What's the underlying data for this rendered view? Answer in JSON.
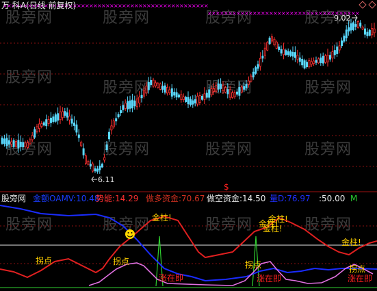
{
  "header": {
    "title": "万  科A(日线 前复权)"
  },
  "price_panel": {
    "high_label": "9.02",
    "low_label": "6.11",
    "candle_up_color": "#ff3030",
    "candle_down_color": "#5ad9ff",
    "marker_color": "#ff00ff",
    "dollar_sign": "$"
  },
  "indicator_bar": {
    "source": "股旁网",
    "items": [
      {
        "label": "金额OAMV:",
        "value": "10.48",
        "color": "#1a3cff"
      },
      {
        "label": "势能:",
        "value": "14.29",
        "color": "#ff3030"
      },
      {
        "label": "做多资金:",
        "value": "70.67",
        "color": "#d03020"
      },
      {
        "label": "做空资金:",
        "value": "14.50",
        "color": "#e8e8e8"
      },
      {
        "label": "量D:",
        "value": "76.97",
        "color": "#2030ff"
      },
      {
        "label": ":",
        "value": "50.00",
        "color": "#e8e8e8"
      },
      {
        "label": "M",
        "value": "",
        "color": "#28d030"
      }
    ]
  },
  "annotations": {
    "turning_point": "拐点",
    "golden_pillar": "金柱!",
    "rise_now": "涨在即",
    "smiley": "☺"
  },
  "watermark": "股旁网"
}
